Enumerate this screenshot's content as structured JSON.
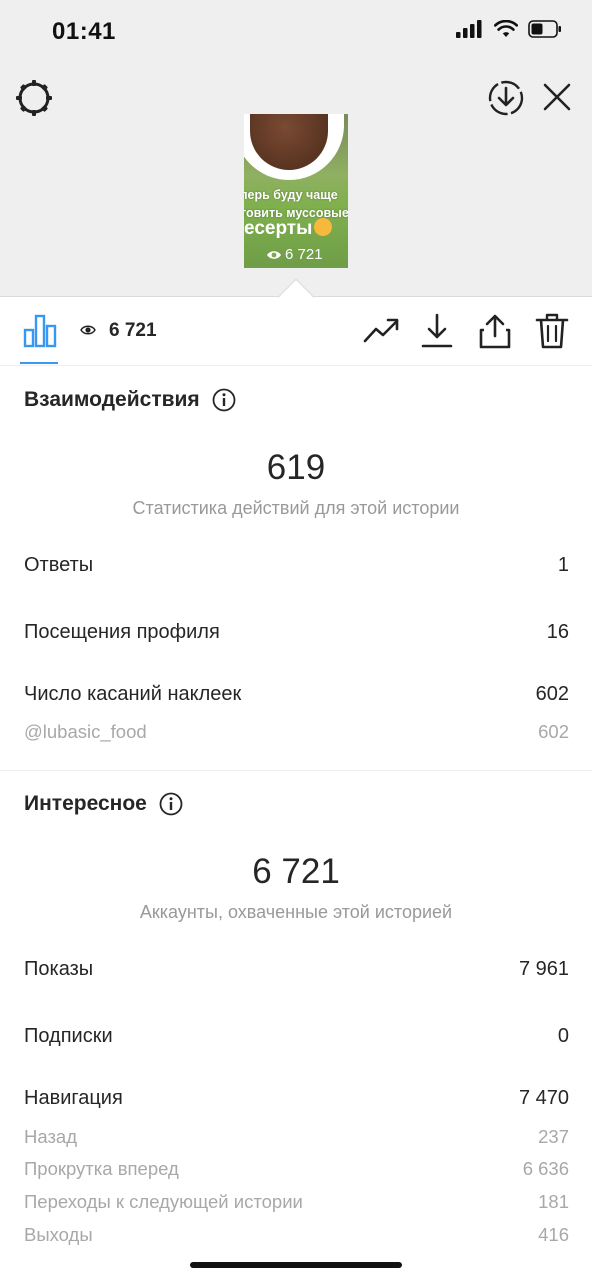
{
  "status_bar": {
    "time": "01:41"
  },
  "story_preview": {
    "text_line1": "перь буду чаще",
    "text_line2": "товить муссовые",
    "text_line3": "есерты",
    "view_count": "6 721"
  },
  "toolbar": {
    "view_count": "6 721"
  },
  "interactions": {
    "title": "Взаимодействия",
    "total": "619",
    "subtitle": "Статистика действий для этой истории",
    "rows": [
      {
        "label": "Ответы",
        "value": "1"
      },
      {
        "label": "Посещения профиля",
        "value": "16"
      },
      {
        "label": "Число касаний наклеек",
        "value": "602"
      }
    ],
    "sticker_rows": [
      {
        "label": "@lubasic_food",
        "value": "602"
      }
    ]
  },
  "discovery": {
    "title": "Интересное",
    "total": "6 721",
    "subtitle": "Аккаунты, охваченные этой историей",
    "rows": [
      {
        "label": "Показы",
        "value": "7 961"
      },
      {
        "label": "Подписки",
        "value": "0"
      },
      {
        "label": "Навигация",
        "value": "7 470"
      }
    ],
    "navigation_rows": [
      {
        "label": "Назад",
        "value": "237"
      },
      {
        "label": "Прокрутка вперед",
        "value": "6 636"
      },
      {
        "label": "Переходы к следующей истории",
        "value": "181"
      },
      {
        "label": "Выходы",
        "value": "416"
      }
    ]
  },
  "colors": {
    "accent": "#3897f0",
    "text": "#262626",
    "muted": "#999999"
  }
}
